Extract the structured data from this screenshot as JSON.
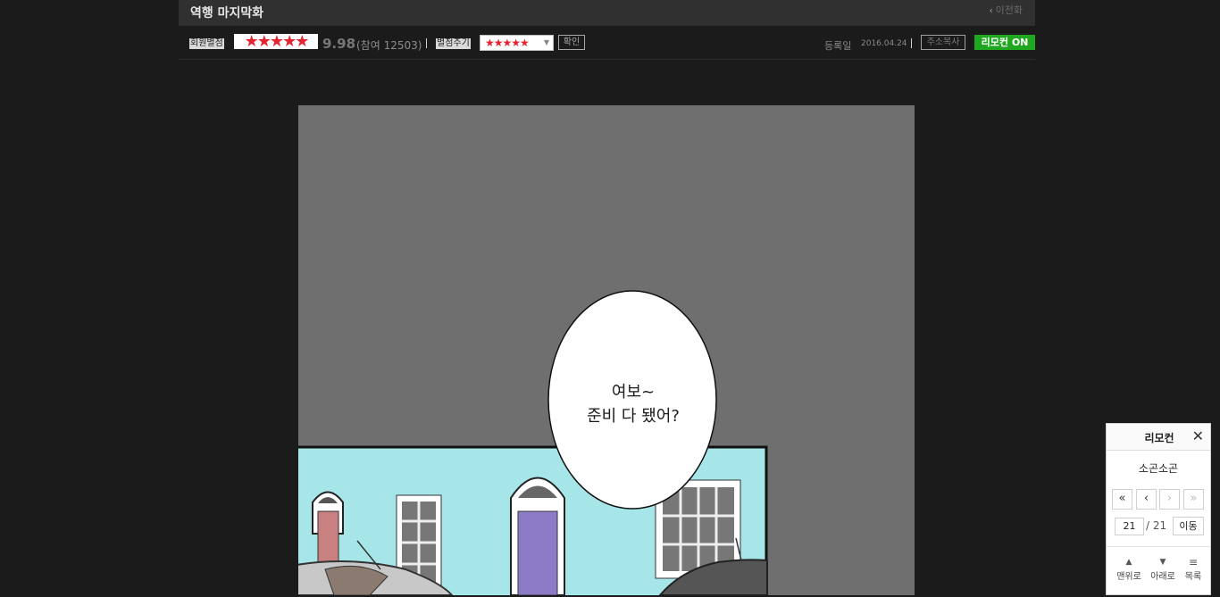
{
  "header": {
    "title": "역행 마지막화",
    "prev_episode": "이전화"
  },
  "rating": {
    "label": "회원별점",
    "stars": "★★★★★",
    "score": "9.98",
    "participants": "(참여 12503)",
    "give_label": "별점주기",
    "select_stars": "★★★★★",
    "confirm": "확인"
  },
  "meta": {
    "reg_label": "등록일",
    "reg_date": "2016.04.24",
    "copy_url": "주소복사",
    "remote_toggle": "리모컨 ON"
  },
  "comic": {
    "speech_line1": "여보~",
    "speech_line2": "준비 다 됐어?"
  },
  "remote": {
    "title": "리모컨",
    "close": "✕",
    "series_name": "소곤소곤",
    "first": "«",
    "prev": "‹",
    "next": "›",
    "last": "»",
    "page_current": "21",
    "page_total": "/ 21",
    "go": "이동",
    "top": "맨위로",
    "down": "아래로",
    "list": "목록"
  },
  "colors": {
    "background": "#1b1b1b",
    "star_red": "#e4252f",
    "remote_on_green": "#1fa81f",
    "canvas_gray": "#6f6f6f",
    "sky_cyan": "#a6e6e8"
  }
}
